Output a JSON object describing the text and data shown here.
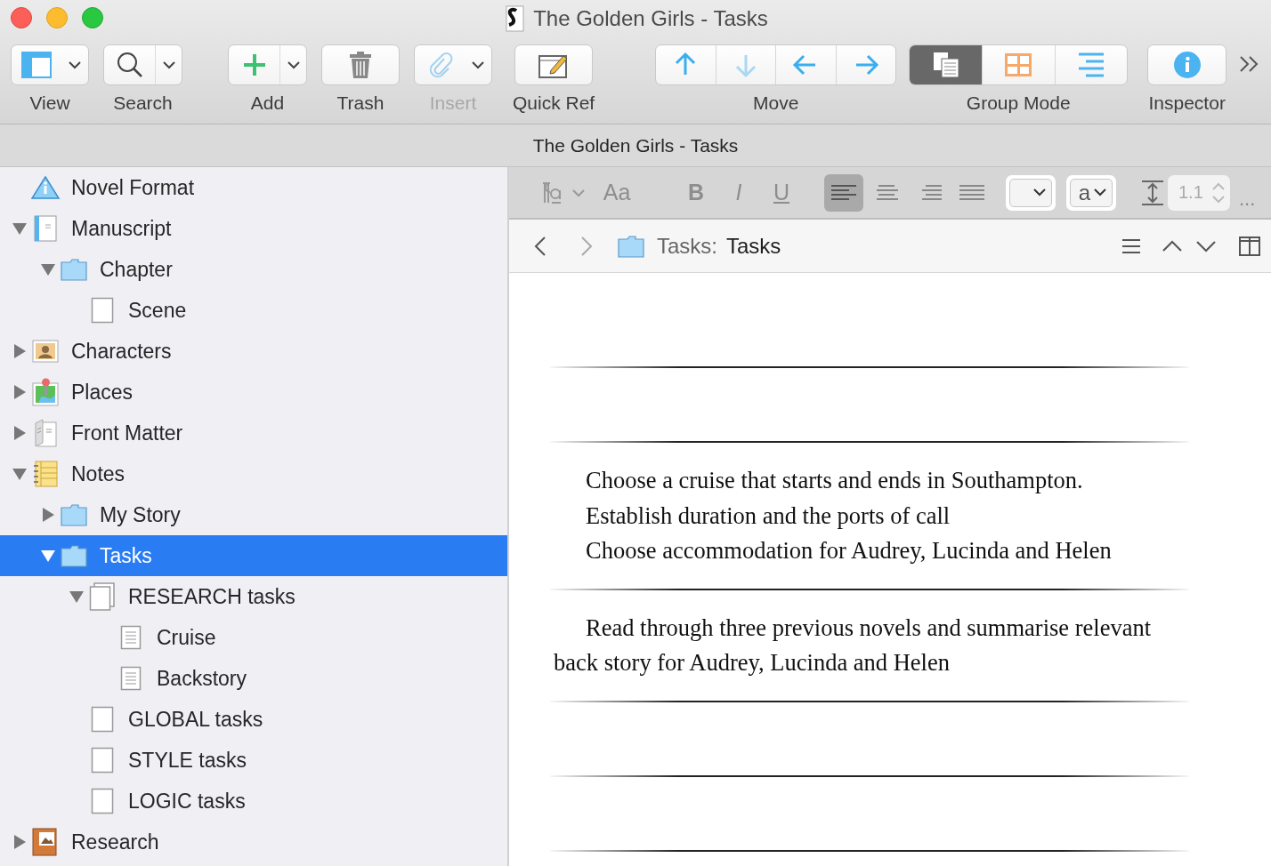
{
  "window": {
    "title": "The Golden Girls - Tasks"
  },
  "toolbar": {
    "items": [
      {
        "label": "View",
        "dropdown": true,
        "disabled": false
      },
      {
        "label": "Search",
        "dropdown": true,
        "disabled": false
      },
      {
        "label": "Add",
        "dropdown": true,
        "disabled": false
      },
      {
        "label": "Trash",
        "dropdown": false,
        "disabled": false
      },
      {
        "label": "Insert",
        "dropdown": true,
        "disabled": true
      },
      {
        "label": "Quick Ref",
        "dropdown": false,
        "disabled": false
      }
    ],
    "move": {
      "label": "Move",
      "segments": [
        {
          "disabled": false
        },
        {
          "disabled": true
        },
        {
          "disabled": false
        },
        {
          "disabled": false
        }
      ]
    },
    "group_mode": {
      "label": "Group Mode",
      "segments": [
        {
          "selected": true
        },
        {
          "selected": false
        },
        {
          "selected": false
        }
      ]
    },
    "inspector": {
      "label": "Inspector"
    }
  },
  "subtitle": "The Golden Girls - Tasks",
  "binder": [
    {
      "label": "Novel Format",
      "kind": "info",
      "selected": false
    },
    {
      "label": "Manuscript",
      "kind": "manuscript",
      "selected": false,
      "expanded": true,
      "children": [
        {
          "label": "Chapter",
          "kind": "folder",
          "selected": false,
          "expanded": true,
          "children": [
            {
              "label": "Scene",
              "kind": "blank",
              "selected": false
            }
          ]
        }
      ]
    },
    {
      "label": "Characters",
      "kind": "characters",
      "selected": false,
      "expanded": false
    },
    {
      "label": "Places",
      "kind": "places",
      "selected": false,
      "expanded": false
    },
    {
      "label": "Front Matter",
      "kind": "frontmatter",
      "selected": false,
      "expanded": false
    },
    {
      "label": "Notes",
      "kind": "notes",
      "selected": false,
      "expanded": true,
      "children": [
        {
          "label": "My Story",
          "kind": "folder",
          "selected": false,
          "expanded": false
        },
        {
          "label": "Tasks",
          "kind": "folder",
          "selected": true,
          "expanded": true,
          "children": [
            {
              "label": "RESEARCH tasks",
              "kind": "stack",
              "selected": false,
              "expanded": true,
              "children": [
                {
                  "label": "Cruise",
                  "kind": "document",
                  "selected": false
                },
                {
                  "label": "Backstory",
                  "kind": "document",
                  "selected": false
                }
              ]
            },
            {
              "label": "GLOBAL tasks",
              "kind": "blank",
              "selected": false
            },
            {
              "label": "STYLE tasks",
              "kind": "blank",
              "selected": false
            },
            {
              "label": "LOGIC tasks",
              "kind": "blank",
              "selected": false
            }
          ]
        }
      ]
    },
    {
      "label": "Research",
      "kind": "research",
      "selected": false,
      "expanded": false
    }
  ],
  "format_bar": {
    "font_button": "Aa",
    "style_buttons": [
      "B",
      "I",
      "U"
    ],
    "alignments": [
      {
        "selected": true
      },
      {
        "selected": false
      },
      {
        "selected": false
      },
      {
        "selected": false
      }
    ],
    "style_select": "a",
    "line_spacing": "1.1",
    "more": "..."
  },
  "editor_header": {
    "path_label": "Tasks:",
    "title": "Tasks"
  },
  "documents": [
    {
      "kind": "empty"
    },
    {
      "kind": "empty"
    },
    {
      "kind": "text",
      "paragraphs": [
        "Choose a cruise that starts and ends in Southampton.",
        "Establish duration and the ports of call",
        "Choose accommodation for Audrey, Lucinda and Helen"
      ]
    },
    {
      "kind": "text",
      "paragraphs": [
        "Read through three previous novels and summarise relevant back story for Audrey, Lucinda and Helen"
      ]
    },
    {
      "kind": "empty"
    },
    {
      "kind": "empty"
    }
  ]
}
